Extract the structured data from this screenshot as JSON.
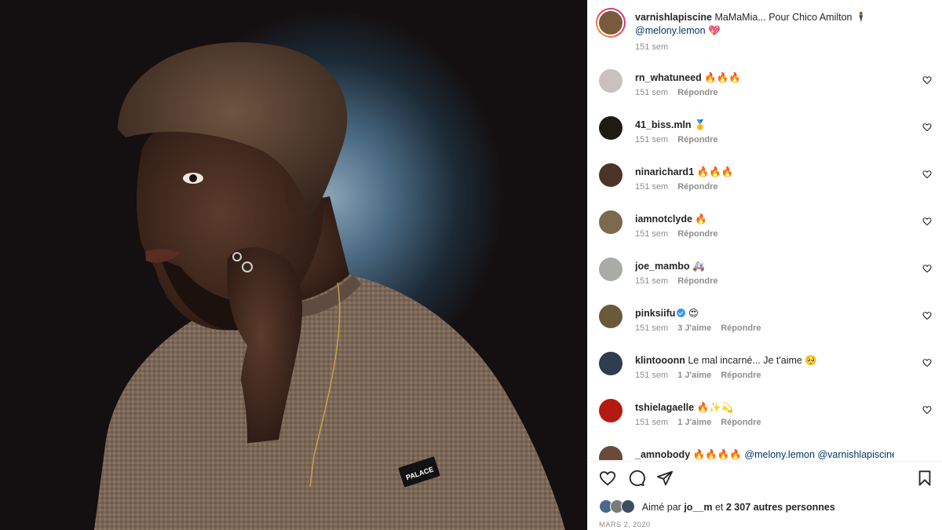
{
  "post": {
    "caption_user": "varnishlapiscine",
    "caption_text": "MaMaMia... Pour Chico Amilton 🕴",
    "caption_mention": "@melony.lemon",
    "caption_emoji": "💖",
    "caption_time": "151 sem",
    "shirt_brand": "PALACE"
  },
  "comments": [
    {
      "user": "rn_whatuneed",
      "text": "🔥🔥🔥",
      "time": "151 sem",
      "likes": "",
      "reply": "Répondre",
      "avatar_color": "#c9c1c0"
    },
    {
      "user": "41_biss.mln",
      "text": "🥇",
      "time": "151 sem",
      "likes": "",
      "reply": "Répondre",
      "avatar_color": "#1e1a14"
    },
    {
      "user": "ninarichard1",
      "text": "🔥🔥🔥",
      "time": "151 sem",
      "likes": "",
      "reply": "Répondre",
      "avatar_color": "#4a3428"
    },
    {
      "user": "iamnotclyde",
      "text": "🔥",
      "time": "151 sem",
      "likes": "",
      "reply": "Répondre",
      "avatar_color": "#7d6a4e"
    },
    {
      "user": "joe_mambo",
      "text": "🚑",
      "time": "151 sem",
      "likes": "",
      "reply": "Répondre",
      "avatar_color": "#a8aba6"
    },
    {
      "user": "pinksiifu",
      "text": "😍",
      "time": "151 sem",
      "likes": "3 J'aime",
      "reply": "Répondre",
      "avatar_color": "#6b5a3a"
    },
    {
      "user": "klintooonn",
      "text": "Le mal incarné... Je t'aime 🥺",
      "time": "151 sem",
      "likes": "1 J'aime",
      "reply": "Répondre",
      "avatar_color": "#2f3d4e"
    },
    {
      "user": "tshielagaelle",
      "text": "🔥✨💫",
      "time": "151 sem",
      "likes": "1 J'aime",
      "reply": "Répondre",
      "avatar_color": "#b51a10"
    },
    {
      "user": "_amnobody",
      "text": "🔥🔥🔥🔥",
      "mentions": "@melony.lemon @varnishlapiscine",
      "time": "",
      "likes": "",
      "reply": "",
      "avatar_color": "#6a4a3a"
    }
  ],
  "actions": {
    "like_icon": "heart-icon",
    "comment_icon": "comment-icon",
    "share_icon": "paper-plane-icon",
    "save_icon": "bookmark-icon"
  },
  "likes": {
    "prefix": "Aimé par",
    "first_user": "jo__m",
    "middle": "et",
    "others": "2 307 autres personnes"
  },
  "date": "MARS 2, 2020"
}
